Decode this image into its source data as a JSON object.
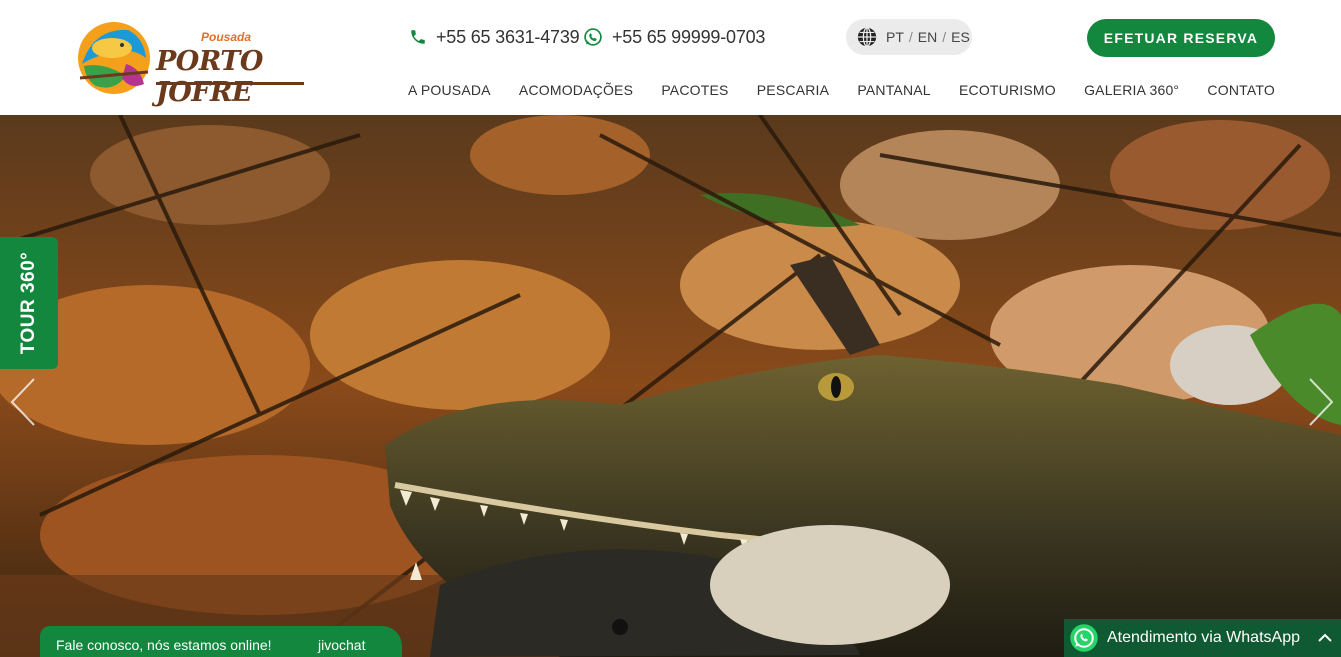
{
  "header": {
    "logo_small": "Pousada",
    "logo_big": "PORTO JOFRE",
    "phone": "+55 65 3631-4739",
    "whatsapp": "+55 65 99999-0703",
    "languages": [
      "PT",
      "EN",
      "ES"
    ],
    "reserve_label": "EFETUAR RESERVA"
  },
  "nav": {
    "items": [
      "A POUSADA",
      "ACOMODAÇÕES",
      "PACOTES",
      "PESCARIA",
      "PANTANAL",
      "ECOTURISMO",
      "GALERIA 360°",
      "CONTATO"
    ]
  },
  "hero": {
    "tour_label": "TOUR 360°"
  },
  "chat": {
    "message": "Fale conosco, nós estamos online!",
    "brand": "jivochat"
  },
  "whatsapp_widget": {
    "label": "Atendimento via WhatsApp"
  },
  "colors": {
    "accent_green": "#12873d",
    "whatsapp_dark": "#0f5a32"
  }
}
